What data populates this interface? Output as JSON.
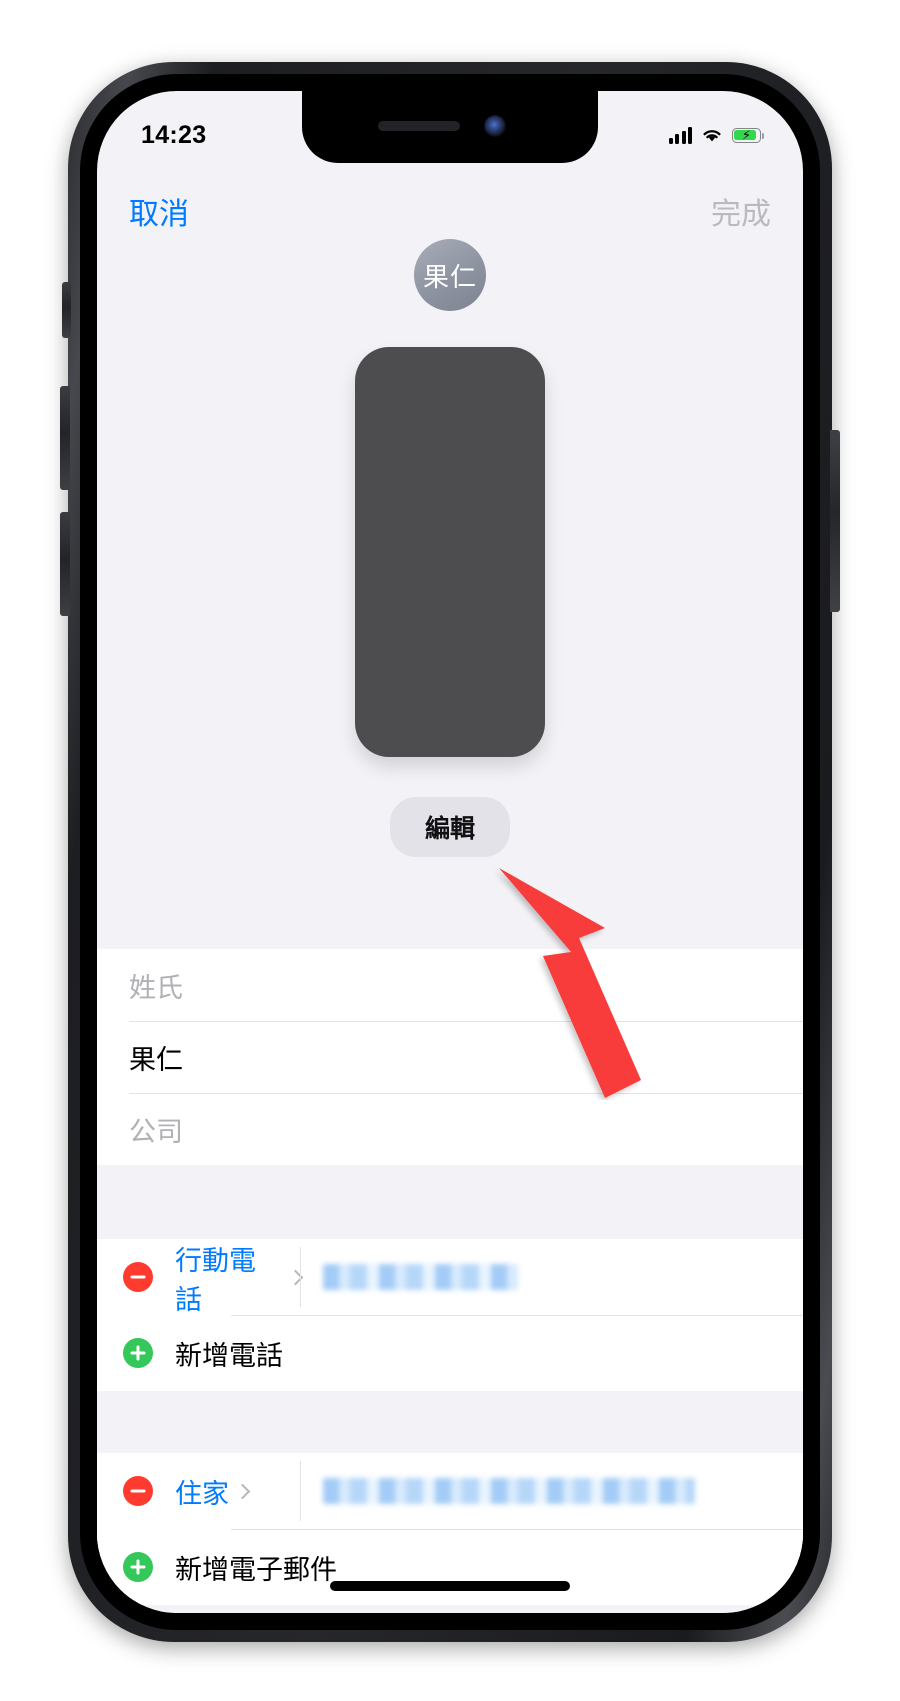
{
  "status_bar": {
    "time": "14:23",
    "signal_icon": "cellular-bars-icon",
    "wifi_icon": "wifi-icon",
    "battery_icon": "battery-charging-icon",
    "battery_bolt": "⚡"
  },
  "nav_bar": {
    "cancel_label": "取消",
    "done_label": "完成"
  },
  "header": {
    "avatar_initials": "果仁",
    "edit_photo_label": "編輯"
  },
  "name_fields": [
    {
      "text": "姓氏",
      "is_placeholder": true
    },
    {
      "text": "果仁",
      "is_placeholder": false
    },
    {
      "text": "公司",
      "is_placeholder": true
    }
  ],
  "phone_section": {
    "rows": [
      {
        "label": "行動電話",
        "value": "",
        "redacted": true
      }
    ],
    "add_label": "新增電話"
  },
  "email_section": {
    "rows": [
      {
        "label": "住家",
        "value": "",
        "redacted": true
      }
    ],
    "add_label": "新增電子郵件"
  },
  "colors": {
    "accent_blue": "#007aff",
    "delete_red": "#ff3b30",
    "add_green": "#34c759",
    "battery_green": "#32d74b",
    "arrow_red": "#f83a3a",
    "group_bg": "#f2f2f7"
  }
}
